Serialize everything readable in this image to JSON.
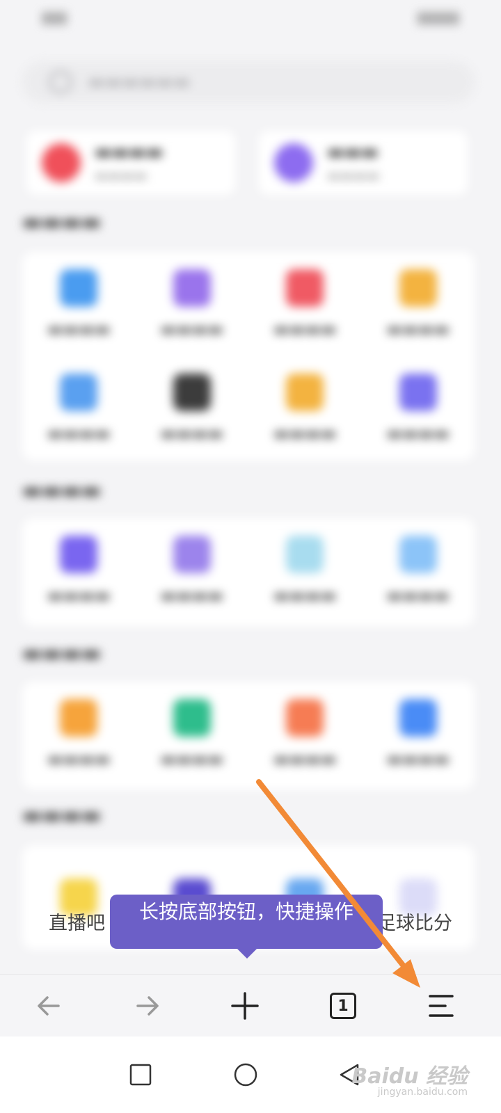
{
  "tooltip": {
    "text": "长按底部按钮，快捷操作"
  },
  "visible_labels": {
    "left": "直播吧",
    "right": "足球比分"
  },
  "toolbar": {
    "tab_count": "1"
  },
  "watermark": {
    "brand": "Baidu 经验",
    "url": "jingyan.baidu.com"
  },
  "colors": {
    "arrow": "#f28a36",
    "tooltip_bg": "#6c5fc7",
    "accent": "#6c5fc7"
  },
  "icons": {
    "toolbar": [
      "back-arrow-icon",
      "forward-arrow-icon",
      "plus-icon",
      "tabs-icon",
      "menu-icon"
    ],
    "navbar": [
      "square-icon",
      "circle-icon",
      "triangle-back-icon"
    ]
  },
  "blurred_colors": {
    "feature": [
      "#f0505a",
      "#8d6cf0"
    ],
    "row1": [
      "#4a9cf0",
      "#9a74ec",
      "#f05a64",
      "#f3b340"
    ],
    "row2": [
      "#5aa0f0",
      "#3c3c3c",
      "#f3b340",
      "#7a72f0"
    ],
    "row3": [
      "#7a66f0",
      "#9c84ec",
      "#a8dcef",
      "#8cc4f8"
    ],
    "row4": [
      "#f6a43c",
      "#2ebd8c",
      "#f67c54",
      "#4a8cf6"
    ],
    "row5": [
      "#f6d54c",
      "#5a4cd0",
      "#68a8f0",
      "#dcdcf8"
    ]
  }
}
